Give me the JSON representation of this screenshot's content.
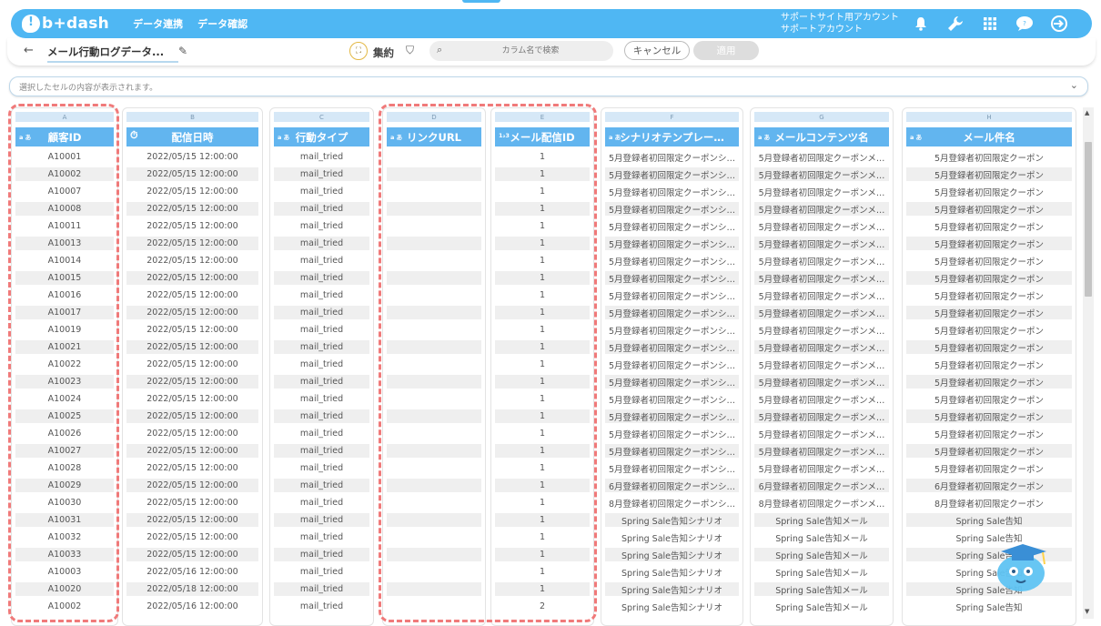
{
  "app": {
    "logo_text": "b+dash",
    "nav": [
      "データ連携",
      "データ確認"
    ],
    "account_line1": "サポートサイト用アカウント",
    "account_line2": "サポートアカウント",
    "top_icons": [
      "bell-icon",
      "wrench-icon",
      "apps-grid-icon",
      "chat-icon",
      "logout-icon"
    ]
  },
  "toolbar": {
    "back_icon": "arrow-left-icon",
    "title": "メール行動ログデータ...",
    "aggregate_label": "集約",
    "search_placeholder": "カラム名で検索",
    "cancel_label": "キャンセル",
    "apply_label": "適用"
  },
  "cellbar": {
    "placeholder": "選択したセルの内容が表示されます。"
  },
  "table": {
    "columns": [
      {
        "letter": "A",
        "name": "顧客ID",
        "type": "text"
      },
      {
        "letter": "B",
        "name": "配信日時",
        "type": "datetime"
      },
      {
        "letter": "C",
        "name": "行動タイプ",
        "type": "text"
      },
      {
        "letter": "D",
        "name": "リンクURL",
        "type": "text"
      },
      {
        "letter": "E",
        "name": "メール配信ID",
        "type": "number"
      },
      {
        "letter": "F",
        "name": "シナリオテンプレー…",
        "type": "text"
      },
      {
        "letter": "G",
        "name": "メールコンテンツ名",
        "type": "text"
      },
      {
        "letter": "H",
        "name": "メール件名",
        "type": "text"
      }
    ],
    "type_badges": {
      "text": "a あ",
      "number": "1₂3",
      "datetime": "⏱"
    },
    "rows": [
      [
        "A10001",
        "2022/05/15 12:00:00",
        "mail_tried",
        "",
        "1",
        "5月登録者初回限定クーポンシ…",
        "5月登録者初回限定クーポンメ…",
        "5月登録者初回限定クーポン"
      ],
      [
        "A10002",
        "2022/05/15 12:00:00",
        "mail_tried",
        "",
        "1",
        "5月登録者初回限定クーポンシ…",
        "5月登録者初回限定クーポンメ…",
        "5月登録者初回限定クーポン"
      ],
      [
        "A10007",
        "2022/05/15 12:00:00",
        "mail_tried",
        "",
        "1",
        "5月登録者初回限定クーポンシ…",
        "5月登録者初回限定クーポンメ…",
        "5月登録者初回限定クーポン"
      ],
      [
        "A10008",
        "2022/05/15 12:00:00",
        "mail_tried",
        "",
        "1",
        "5月登録者初回限定クーポンシ…",
        "5月登録者初回限定クーポンメ…",
        "5月登録者初回限定クーポン"
      ],
      [
        "A10011",
        "2022/05/15 12:00:00",
        "mail_tried",
        "",
        "1",
        "5月登録者初回限定クーポンシ…",
        "5月登録者初回限定クーポンメ…",
        "5月登録者初回限定クーポン"
      ],
      [
        "A10013",
        "2022/05/15 12:00:00",
        "mail_tried",
        "",
        "1",
        "5月登録者初回限定クーポンシ…",
        "5月登録者初回限定クーポンメ…",
        "5月登録者初回限定クーポン"
      ],
      [
        "A10014",
        "2022/05/15 12:00:00",
        "mail_tried",
        "",
        "1",
        "5月登録者初回限定クーポンシ…",
        "5月登録者初回限定クーポンメ…",
        "5月登録者初回限定クーポン"
      ],
      [
        "A10015",
        "2022/05/15 12:00:00",
        "mail_tried",
        "",
        "1",
        "5月登録者初回限定クーポンシ…",
        "5月登録者初回限定クーポンメ…",
        "5月登録者初回限定クーポン"
      ],
      [
        "A10016",
        "2022/05/15 12:00:00",
        "mail_tried",
        "",
        "1",
        "5月登録者初回限定クーポンシ…",
        "5月登録者初回限定クーポンメ…",
        "5月登録者初回限定クーポン"
      ],
      [
        "A10017",
        "2022/05/15 12:00:00",
        "mail_tried",
        "",
        "1",
        "5月登録者初回限定クーポンシ…",
        "5月登録者初回限定クーポンメ…",
        "5月登録者初回限定クーポン"
      ],
      [
        "A10019",
        "2022/05/15 12:00:00",
        "mail_tried",
        "",
        "1",
        "5月登録者初回限定クーポンシ…",
        "5月登録者初回限定クーポンメ…",
        "5月登録者初回限定クーポン"
      ],
      [
        "A10021",
        "2022/05/15 12:00:00",
        "mail_tried",
        "",
        "1",
        "5月登録者初回限定クーポンシ…",
        "5月登録者初回限定クーポンメ…",
        "5月登録者初回限定クーポン"
      ],
      [
        "A10022",
        "2022/05/15 12:00:00",
        "mail_tried",
        "",
        "1",
        "5月登録者初回限定クーポンシ…",
        "5月登録者初回限定クーポンメ…",
        "5月登録者初回限定クーポン"
      ],
      [
        "A10023",
        "2022/05/15 12:00:00",
        "mail_tried",
        "",
        "1",
        "5月登録者初回限定クーポンシ…",
        "5月登録者初回限定クーポンメ…",
        "5月登録者初回限定クーポン"
      ],
      [
        "A10024",
        "2022/05/15 12:00:00",
        "mail_tried",
        "",
        "1",
        "5月登録者初回限定クーポンシ…",
        "5月登録者初回限定クーポンメ…",
        "5月登録者初回限定クーポン"
      ],
      [
        "A10025",
        "2022/05/15 12:00:00",
        "mail_tried",
        "",
        "1",
        "5月登録者初回限定クーポンシ…",
        "5月登録者初回限定クーポンメ…",
        "5月登録者初回限定クーポン"
      ],
      [
        "A10026",
        "2022/05/15 12:00:00",
        "mail_tried",
        "",
        "1",
        "5月登録者初回限定クーポンシ…",
        "5月登録者初回限定クーポンメ…",
        "5月登録者初回限定クーポン"
      ],
      [
        "A10027",
        "2022/05/15 12:00:00",
        "mail_tried",
        "",
        "1",
        "5月登録者初回限定クーポンシ…",
        "5月登録者初回限定クーポンメ…",
        "5月登録者初回限定クーポン"
      ],
      [
        "A10028",
        "2022/05/15 12:00:00",
        "mail_tried",
        "",
        "1",
        "5月登録者初回限定クーポンシ…",
        "5月登録者初回限定クーポンメ…",
        "5月登録者初回限定クーポン"
      ],
      [
        "A10029",
        "2022/05/15 12:00:00",
        "mail_tried",
        "",
        "1",
        "6月登録者初回限定クーポンシ…",
        "6月登録者初回限定クーポンメ…",
        "6月登録者初回限定クーポン"
      ],
      [
        "A10030",
        "2022/05/15 12:00:00",
        "mail_tried",
        "",
        "1",
        "8月登録者初回限定クーポンシ…",
        "8月登録者初回限定クーポンメ…",
        "8月登録者初回限定クーポン"
      ],
      [
        "A10031",
        "2022/05/15 12:00:00",
        "mail_tried",
        "",
        "1",
        "Spring Sale告知シナリオ",
        "Spring Sale告知メール",
        "Spring Sale告知"
      ],
      [
        "A10032",
        "2022/05/15 12:00:00",
        "mail_tried",
        "",
        "1",
        "Spring Sale告知シナリオ",
        "Spring Sale告知メール",
        "Spring Sale告知"
      ],
      [
        "A10033",
        "2022/05/15 12:00:00",
        "mail_tried",
        "",
        "1",
        "Spring Sale告知シナリオ",
        "Spring Sale告知メール",
        "Spring Sale告知"
      ],
      [
        "A10003",
        "2022/05/16 12:00:00",
        "mail_tried",
        "",
        "1",
        "Spring Sale告知シナリオ",
        "Spring Sale告知メール",
        "Spring Sale告知"
      ],
      [
        "A10020",
        "2022/05/18 12:00:00",
        "mail_tried",
        "",
        "1",
        "Spring Sale告知シナリオ",
        "Spring Sale告知メール",
        "Spring Sale告知"
      ],
      [
        "A10002",
        "2022/05/16 12:00:00",
        "mail_tried",
        "",
        "2",
        "Spring Sale告知シナリオ",
        "Spring Sale告知メール",
        "Spring Sale告知"
      ]
    ]
  }
}
